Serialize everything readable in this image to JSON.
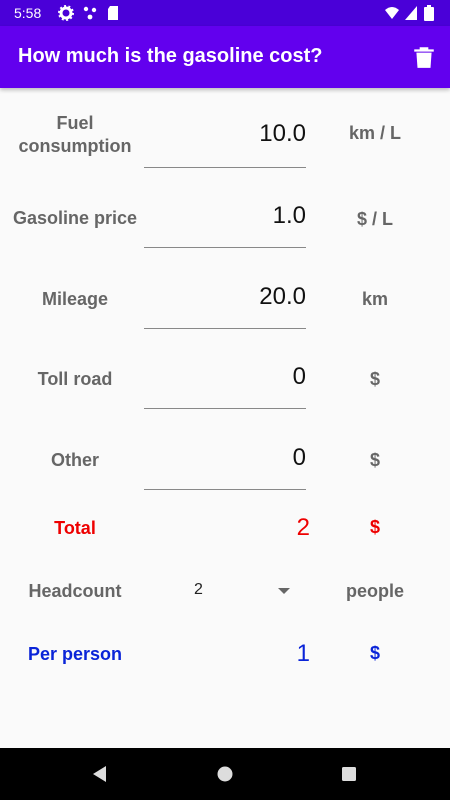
{
  "status_bar": {
    "time": "5:58"
  },
  "app_bar": {
    "title": "How much is the gasoline cost?"
  },
  "fields": {
    "fuel_consumption": {
      "label": "Fuel consumption",
      "value": "10.0",
      "unit": "km / L"
    },
    "gasoline_price": {
      "label": "Gasoline price",
      "value": "1.0",
      "unit": "$ / L"
    },
    "mileage": {
      "label": "Mileage",
      "value": "20.0",
      "unit": "km"
    },
    "toll_road": {
      "label": "Toll road",
      "value": "0",
      "unit": "$"
    },
    "other": {
      "label": "Other",
      "value": "0",
      "unit": "$"
    }
  },
  "total": {
    "label": "Total",
    "value": "2",
    "unit": "$"
  },
  "headcount": {
    "label": "Headcount",
    "selected": "2",
    "unit": "people"
  },
  "per_person": {
    "label": "Per person",
    "value": "1",
    "unit": "$"
  },
  "colors": {
    "primary": "#6200ee",
    "status_bar": "#4a00d8",
    "total": "#ee0000",
    "per_person": "#0a24d8"
  }
}
